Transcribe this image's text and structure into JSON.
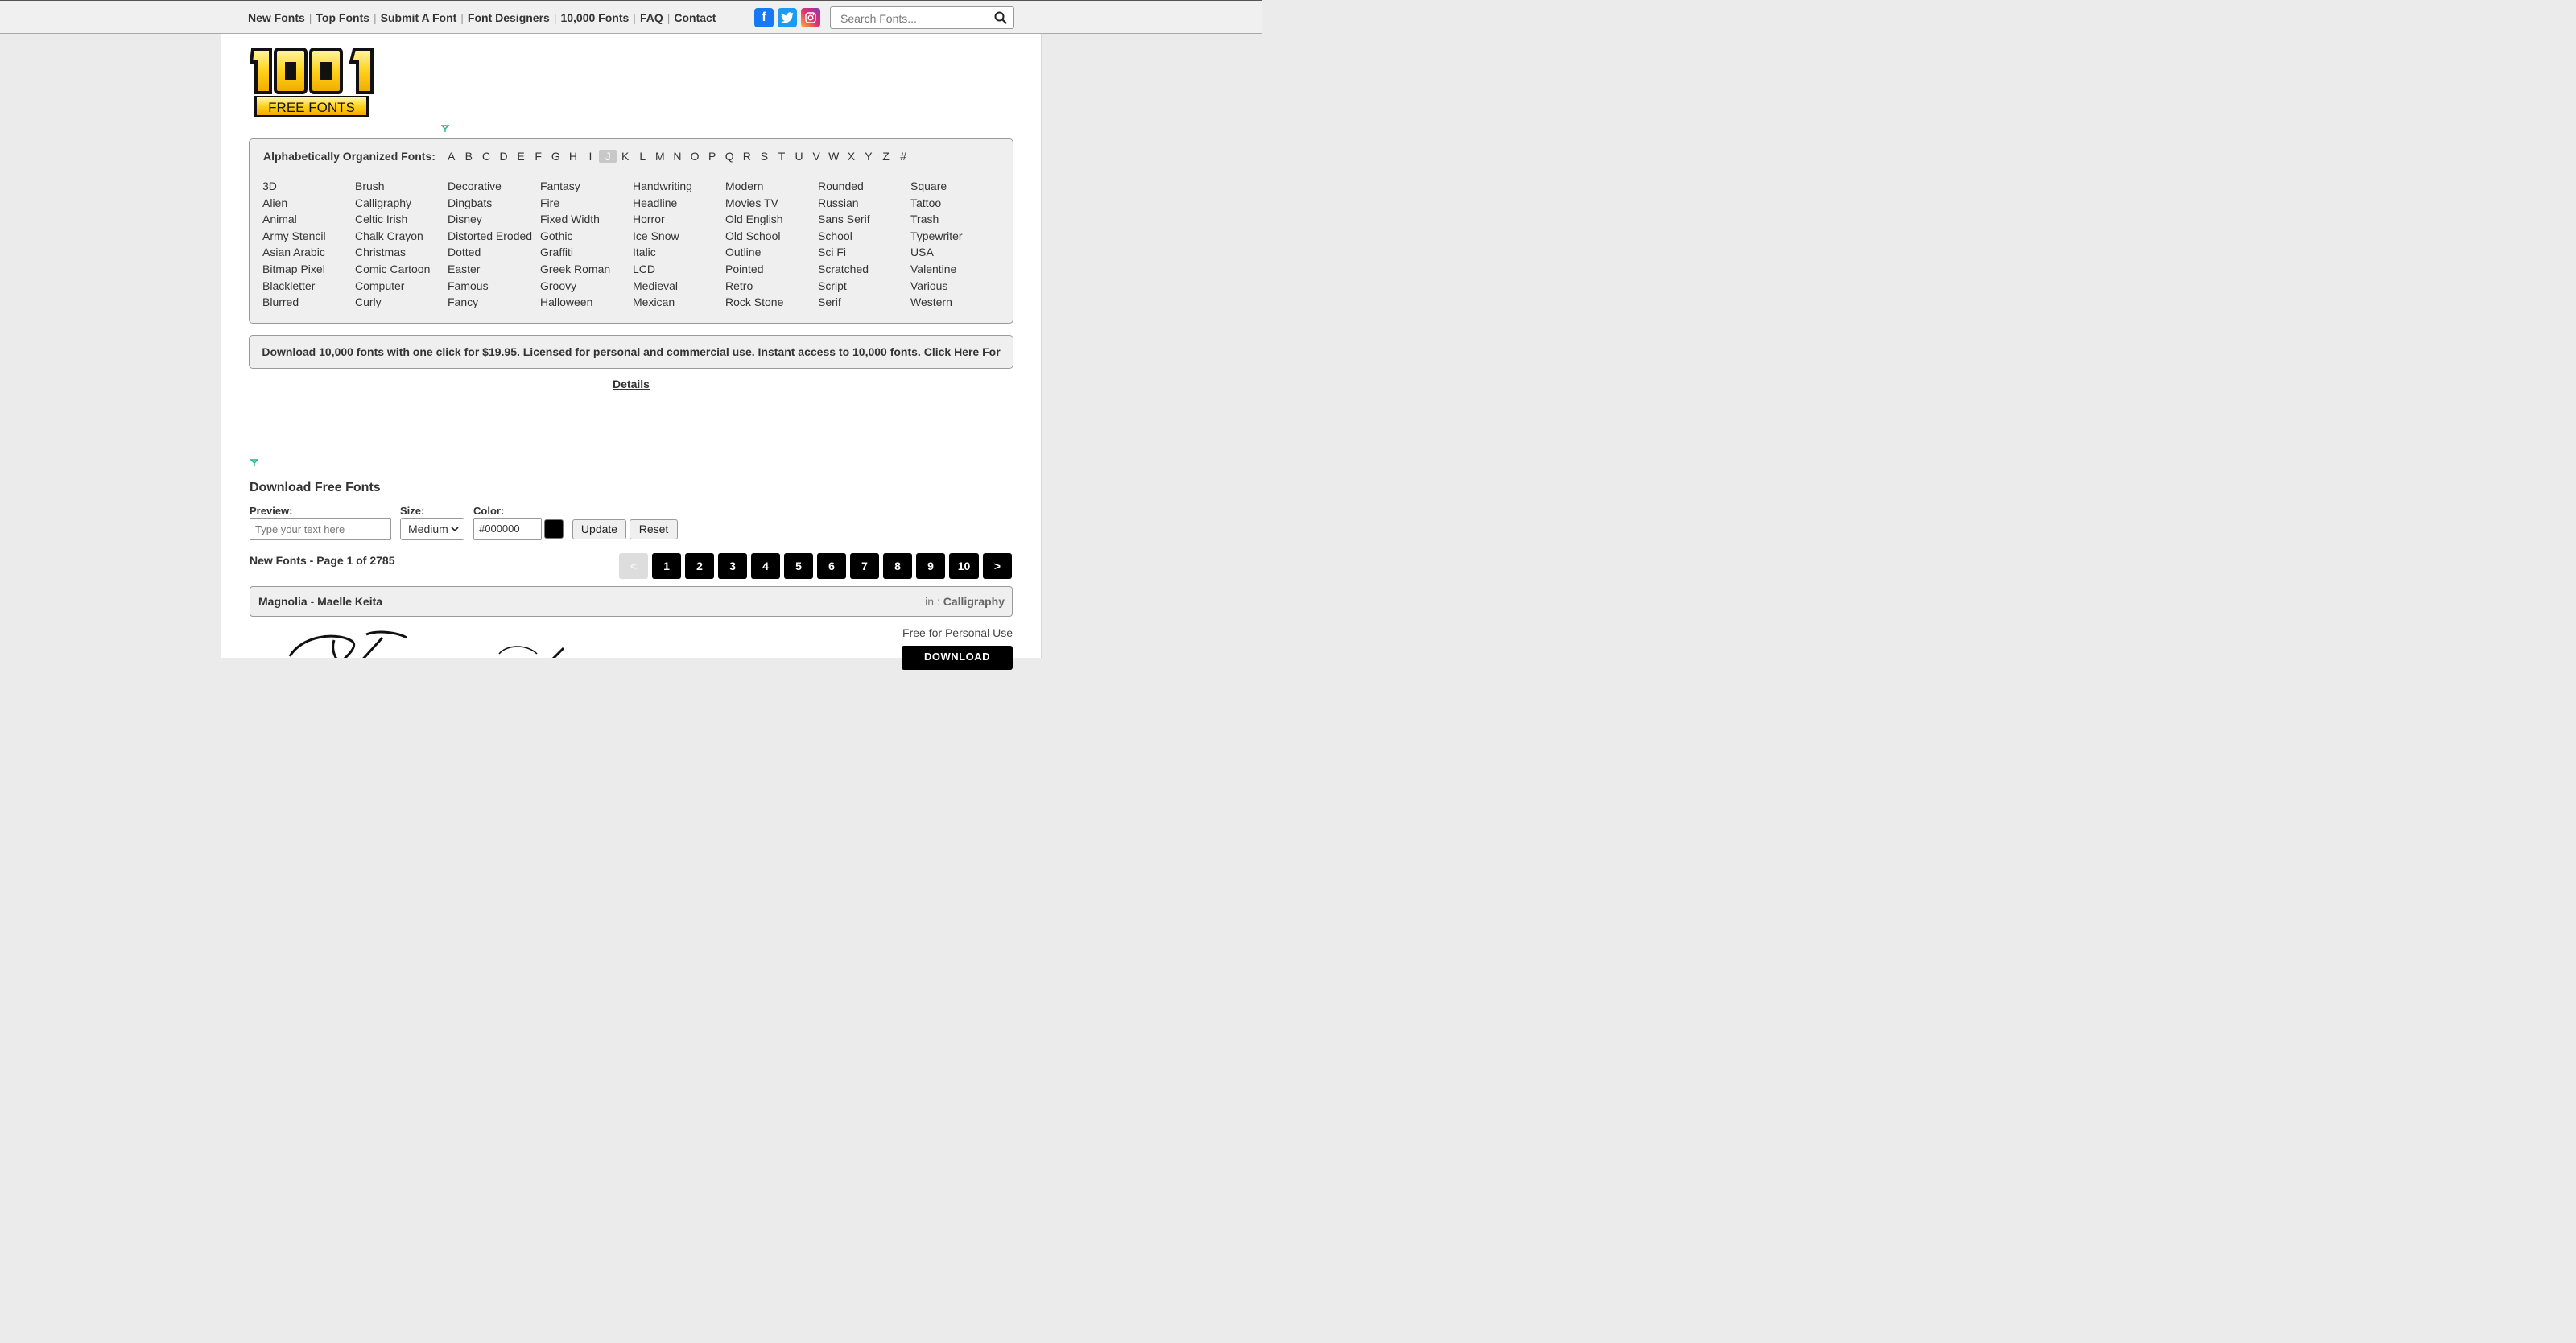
{
  "nav": {
    "items": [
      "New Fonts",
      "Top Fonts",
      "Submit A Font",
      "Font Designers",
      "10,000 Fonts",
      "FAQ",
      "Contact"
    ],
    "separator": "|"
  },
  "social": [
    {
      "name": "facebook",
      "glyph": "f",
      "color": "#1877f2"
    },
    {
      "name": "twitter",
      "glyph": "t",
      "color": "#1d9bf0"
    },
    {
      "name": "instagram",
      "glyph": "",
      "color": "#d6249f"
    }
  ],
  "search": {
    "placeholder": "Search Fonts..."
  },
  "logo": {
    "number": "1001",
    "text": "FREE FONTS"
  },
  "alphabet": {
    "title": "Alphabetically Organized Fonts:",
    "letters": [
      "A",
      "B",
      "C",
      "D",
      "E",
      "F",
      "G",
      "H",
      "I",
      "J",
      "K",
      "L",
      "M",
      "N",
      "O",
      "P",
      "Q",
      "R",
      "S",
      "T",
      "U",
      "V",
      "W",
      "X",
      "Y",
      "Z",
      "#"
    ],
    "active": "J"
  },
  "categories": [
    [
      "3D",
      "Alien",
      "Animal",
      "Army Stencil",
      "Asian Arabic",
      "Bitmap Pixel",
      "Blackletter",
      "Blurred"
    ],
    [
      "Brush",
      "Calligraphy",
      "Celtic Irish",
      "Chalk Crayon",
      "Christmas",
      "Comic Cartoon",
      "Computer",
      "Curly"
    ],
    [
      "Decorative",
      "Dingbats",
      "Disney",
      "Distorted Eroded",
      "Dotted",
      "Easter",
      "Famous",
      "Fancy"
    ],
    [
      "Fantasy",
      "Fire",
      "Fixed Width",
      "Gothic",
      "Graffiti",
      "Greek Roman",
      "Groovy",
      "Halloween"
    ],
    [
      "Handwriting",
      "Headline",
      "Horror",
      "Ice Snow",
      "Italic",
      "LCD",
      "Medieval",
      "Mexican"
    ],
    [
      "Modern",
      "Movies TV",
      "Old English",
      "Old School",
      "Outline",
      "Pointed",
      "Retro",
      "Rock Stone"
    ],
    [
      "Rounded",
      "Russian",
      "Sans Serif",
      "School",
      "Sci Fi",
      "Scratched",
      "Script",
      "Serif"
    ],
    [
      "Square",
      "Tattoo",
      "Trash",
      "Typewriter",
      "USA",
      "Valentine",
      "Various",
      "Western"
    ]
  ],
  "promo": {
    "text": "Download 10,000 fonts with one click for $19.95. Licensed for personal and commercial use. Instant access to 10,000 fonts.",
    "link": "Click Here For Details"
  },
  "download_section": {
    "title": "Download Free Fonts",
    "preview_label": "Preview:",
    "preview_placeholder": "Type your text here",
    "size_label": "Size:",
    "size_value": "Medium",
    "color_label": "Color:",
    "color_value": "#000000",
    "swatch_color": "#000000",
    "update_label": "Update",
    "reset_label": "Reset"
  },
  "listing": {
    "title": "New Fonts - Page 1 of 2785",
    "prev": "<",
    "pages": [
      "1",
      "2",
      "3",
      "4",
      "5",
      "6",
      "7",
      "8",
      "9",
      "10"
    ],
    "next": ">"
  },
  "font": {
    "name": "Magnolia",
    "dash": "-",
    "designer": "Maelle Keita",
    "in_label": "in :",
    "category": "Calligraphy",
    "license": "Free for Personal Use",
    "download_label": "DOWNLOAD"
  }
}
